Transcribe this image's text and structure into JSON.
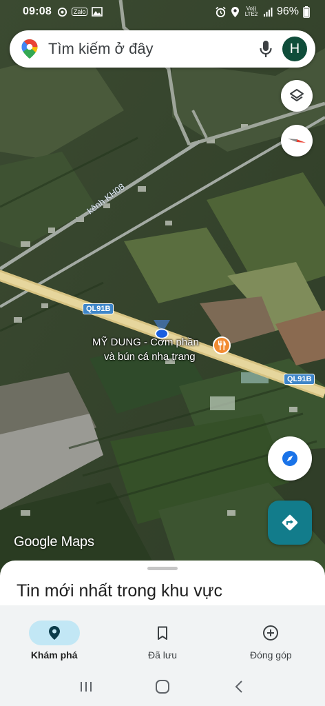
{
  "status_bar": {
    "time": "09:08",
    "left_icons": [
      "sync-icon",
      "zalo-icon",
      "gallery-icon"
    ],
    "zalo_text": "Zalo",
    "volte_text": "Vo)) LTE2",
    "battery": "96%",
    "right_icons": [
      "alarm-icon",
      "location-icon",
      "signal-icon",
      "battery-icon"
    ]
  },
  "search": {
    "placeholder": "Tìm kiếm ở đây",
    "avatar_initial": "H"
  },
  "map": {
    "canal_label": "kênh KH08",
    "road_shield_1": "QL91B",
    "road_shield_2": "QL91B",
    "poi": {
      "line1": "MỸ DUNG - Cơm phần",
      "line2": "và bún cá nha trang",
      "icon": "restaurant-icon"
    },
    "attribution": "Google Maps"
  },
  "sheet": {
    "title": "Tin mới nhất trong khu vực"
  },
  "bottom_nav": [
    {
      "label": "Khám phá",
      "icon": "explore-pin-icon",
      "active": true
    },
    {
      "label": "Đã lưu",
      "icon": "bookmark-icon",
      "active": false
    },
    {
      "label": "Đóng góp",
      "icon": "add-circle-icon",
      "active": false
    }
  ],
  "colors": {
    "accent": "#1a73e8",
    "directions": "#127c8b",
    "nav_active_pill": "#c2e7f5",
    "poi_marker": "#f28b32"
  }
}
